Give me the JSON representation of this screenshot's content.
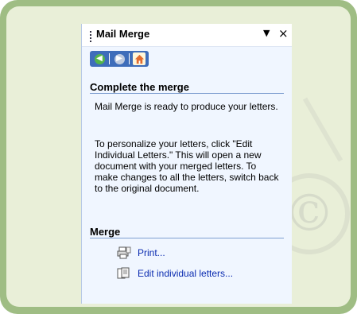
{
  "pane": {
    "title": "Mail Merge",
    "dropdown_glyph": "▼",
    "close_glyph": "×"
  },
  "nav": {
    "back_icon": "back-arrow-icon",
    "forward_icon": "forward-arrow-icon",
    "home_icon": "home-icon"
  },
  "complete": {
    "heading": "Complete the merge",
    "para1": "Mail Merge is ready to produce your letters.",
    "para2": "To personalize your letters, click \"Edit Individual Letters.\" This will open a new document with your merged letters. To make changes to all the letters, switch back to the original document."
  },
  "merge": {
    "heading": "Merge",
    "print_label": "Print...",
    "edit_label": "Edit individual letters..."
  },
  "colors": {
    "frame": "#9fbd84",
    "background": "#e9efd8",
    "pane": "#f0f6ff",
    "link": "#0a2bb0",
    "heading_rule": "#7f9fd1"
  }
}
